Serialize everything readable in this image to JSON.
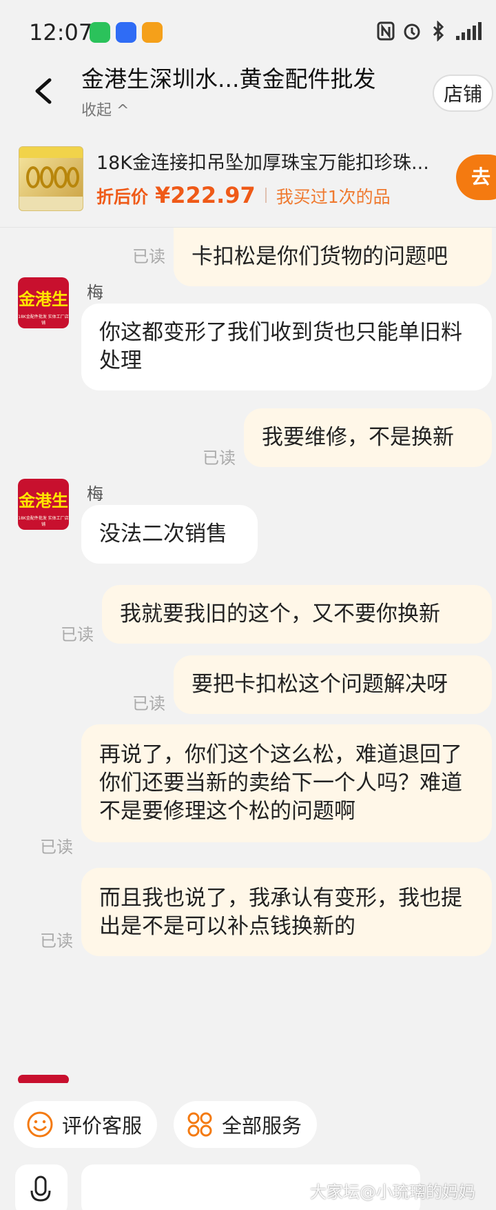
{
  "status_bar": {
    "time": "12:07"
  },
  "header": {
    "title": "金港生深圳水...黄金配件批发",
    "collapse_label": "收起 ^",
    "store_button": "店铺"
  },
  "product": {
    "title": "18K金连接扣吊坠加厚珠宝万能扣珍珠...",
    "price_label": "折后价",
    "price": "¥222.97",
    "bought_text": "我买过1次的品",
    "go_button": "去"
  },
  "chat": {
    "read_label": "已读",
    "seller_avatar_text": "金港生",
    "seller_avatar_sub": "18K金配件批发 实体工厂店铺",
    "messages": [
      {
        "from": "me",
        "text": "卡扣松是你们货物的问题吧"
      },
      {
        "from": "seller",
        "sender": "梅",
        "text": "你这都变形了我们收到货也只能单旧料处理"
      },
      {
        "from": "me",
        "text": "我要维修，不是换新"
      },
      {
        "from": "seller",
        "sender": "梅",
        "text": "没法二次销售"
      },
      {
        "from": "me",
        "text": "我就要我旧的这个，又不要你换新"
      },
      {
        "from": "me",
        "text": "要把卡扣松这个问题解决呀"
      },
      {
        "from": "me",
        "text": "再说了，你们这个这么松，难道退回了你们还要当新的卖给下一个人吗？难道不是要修理这个松的问题啊"
      },
      {
        "from": "me",
        "text": "而且我也说了，我承认有变形，我也提出是不是可以补点钱换新的"
      }
    ]
  },
  "quick_actions": [
    {
      "label": "评价客服",
      "icon": "smiley-icon"
    },
    {
      "label": "全部服务",
      "icon": "services-grid-icon"
    }
  ],
  "watermark": "大家坛@小琉璃的妈妈",
  "colors": {
    "accent": "#f47a10",
    "price": "#ef5a18",
    "my_bubble": "#fff7e8",
    "avatar_bg": "#c8102e"
  }
}
